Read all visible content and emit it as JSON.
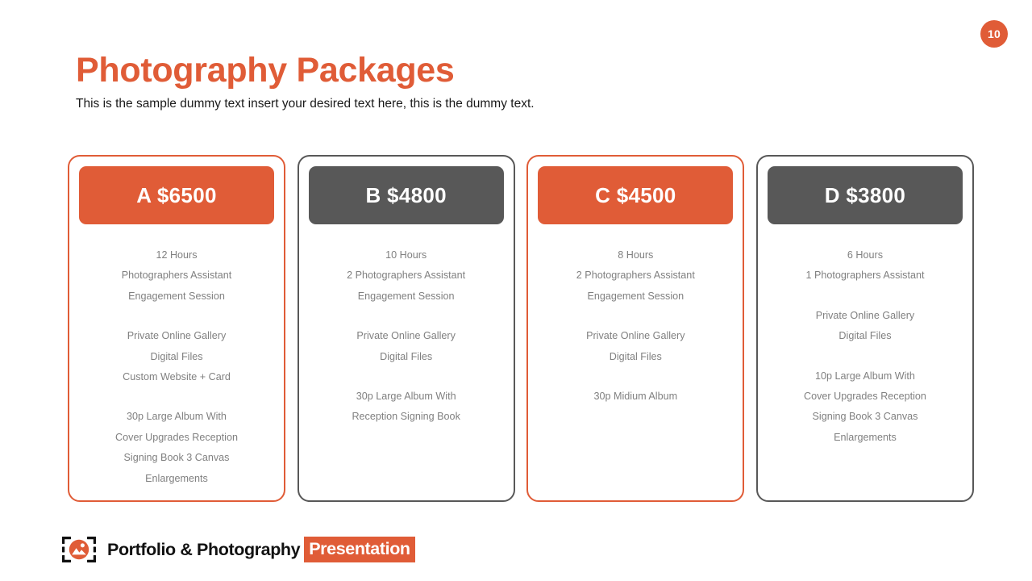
{
  "page_badge": {
    "number": "10",
    "color": "#E05C37"
  },
  "heading": {
    "title": "Photography Packages",
    "subtitle": "This is the sample dummy text insert your desired text here, this is the dummy text.",
    "title_color": "#E05C37"
  },
  "theme": {
    "accent": "#E05C37",
    "dark": "#585858",
    "body_text": "#808080"
  },
  "packages": [
    {
      "id": "a",
      "letter": "A",
      "price": "$6500",
      "header_label": "A $6500",
      "style": "accent",
      "groups": [
        [
          "12 Hours",
          "Photographers Assistant",
          "Engagement Session"
        ],
        [
          "Private Online Gallery",
          "Digital Files",
          "Custom Website + Card"
        ],
        [
          "30p Large Album With",
          "Cover  Upgrades Reception",
          "Signing Book  3 Canvas",
          "Enlargements"
        ]
      ]
    },
    {
      "id": "b",
      "letter": "B",
      "price": "$4800",
      "header_label": "B $4800",
      "style": "dark",
      "groups": [
        [
          "10 Hours",
          "2 Photographers Assistant",
          "Engagement Session"
        ],
        [
          "Private Online Gallery",
          "Digital Files"
        ],
        [
          "30p Large Album With",
          "Reception Signing Book"
        ]
      ]
    },
    {
      "id": "c",
      "letter": "C",
      "price": "$4500",
      "header_label": "C $4500",
      "style": "accent",
      "groups": [
        [
          "8 Hours",
          "2 Photographers Assistant",
          "Engagement Session"
        ],
        [
          "Private Online Gallery",
          "Digital Files"
        ],
        [
          "30p Midium Album"
        ]
      ]
    },
    {
      "id": "d",
      "letter": "D",
      "price": "$3800",
      "header_label": "D $3800",
      "style": "dark",
      "groups": [
        [
          "6 Hours",
          "1 Photographers Assistant"
        ],
        [
          "Private Online Gallery",
          "Digital Files"
        ],
        [
          "10p Large Album With",
          "Cover  Upgrades Reception",
          "Signing Book  3 Canvas",
          "Enlargements"
        ]
      ]
    }
  ],
  "footer": {
    "logo_icon": "photo-frame-icon",
    "brand": "Portfolio & Photography",
    "highlight": "Presentation",
    "highlight_color": "#E05C37"
  }
}
